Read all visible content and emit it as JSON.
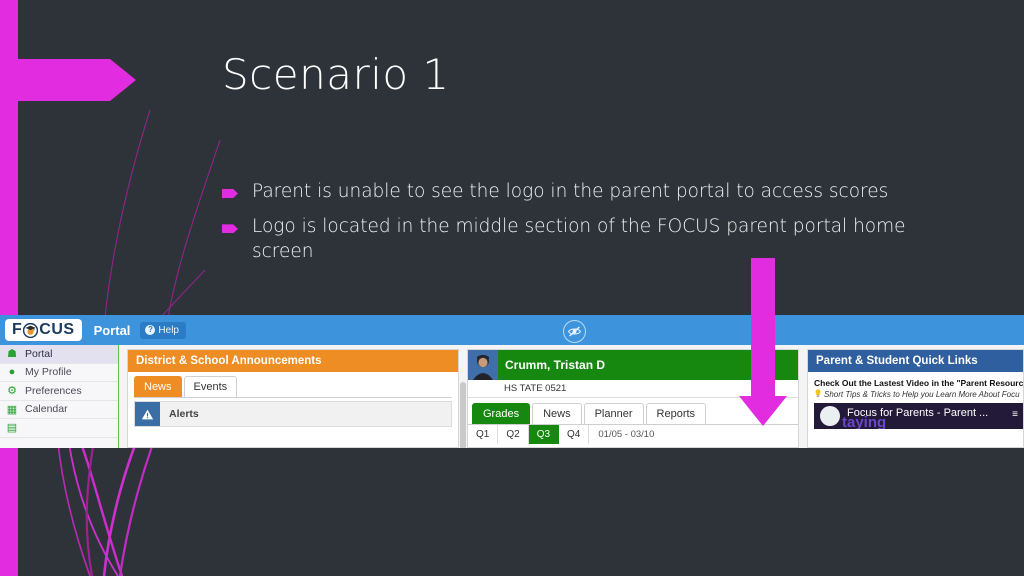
{
  "slide": {
    "title": "Scenario 1",
    "bullets": [
      "Parent is unable to see the logo in the parent portal to access scores",
      "Logo is located in the middle section of the FOCUS parent portal home screen"
    ],
    "accent_color": "#e22ce0",
    "background_color": "#2e333a"
  },
  "screenshot": {
    "topbar": {
      "logo_text_before": "F",
      "logo_icon": "graduation-cap-icon",
      "logo_text_after": "CUS",
      "portal_label": "Portal",
      "help_label": "Help",
      "help_icon": "question-circle-icon",
      "hidden_badge_icon": "eye-slash-icon",
      "background_color": "#3d94dd"
    },
    "sidebar": {
      "items": [
        {
          "label": "Portal",
          "icon": "home-icon",
          "active": true
        },
        {
          "label": "My Profile",
          "icon": "user-icon",
          "active": false
        },
        {
          "label": "Preferences",
          "icon": "gear-icon",
          "active": false
        },
        {
          "label": "Calendar",
          "icon": "calendar-icon",
          "active": false
        }
      ]
    },
    "announcements": {
      "title": "District & School Announcements",
      "tabs": [
        {
          "label": "News",
          "active": true
        },
        {
          "label": "Events",
          "active": false
        }
      ],
      "rows": [
        {
          "label": "Alerts",
          "icon": "warning-triangle-icon"
        }
      ],
      "header_color": "#ee8d23"
    },
    "student": {
      "name": "Crumm, Tristan D",
      "subtitle": "HS TATE 0521",
      "avatar": "student-photo",
      "tabs": [
        {
          "label": "Grades",
          "active": true
        },
        {
          "label": "News",
          "active": false
        },
        {
          "label": "Planner",
          "active": false
        },
        {
          "label": "Reports",
          "active": false
        }
      ],
      "quarters": [
        {
          "label": "Q1",
          "active": false
        },
        {
          "label": "Q2",
          "active": false
        },
        {
          "label": "Q3",
          "active": true
        },
        {
          "label": "Q4",
          "active": false
        }
      ],
      "date_range": "01/05 - 03/10",
      "header_color": "#16880f"
    },
    "quick_links": {
      "title": "Parent & Student Quick Links",
      "line1": "Check Out the Lastest Video in the \"Parent Resourc",
      "line2_icon": "lightbulb-icon",
      "line2": "Short Tips & Tricks to Help you Learn More About Focu",
      "video_title": "Focus for Parents - Parent ...",
      "video_ghost_text": "taying",
      "video_menu_icon": "list-icon",
      "header_color": "#2f5f9e"
    }
  },
  "annotations": {
    "down_arrow": "magenta-down-arrow",
    "left_arrow": "magenta-right-arrow"
  }
}
